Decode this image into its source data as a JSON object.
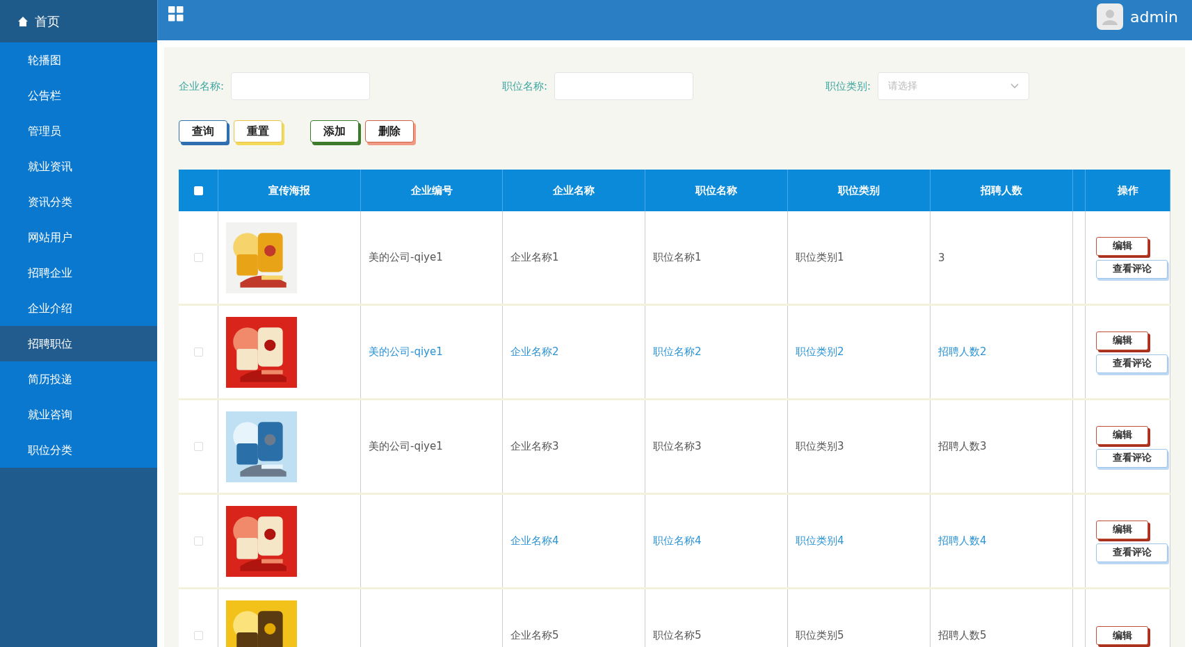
{
  "sidebar": {
    "home": "首页",
    "items": [
      {
        "label": "轮播图",
        "selected": false
      },
      {
        "label": "公告栏",
        "selected": false
      },
      {
        "label": "管理员",
        "selected": false
      },
      {
        "label": "就业资讯",
        "selected": false
      },
      {
        "label": "资讯分类",
        "selected": false
      },
      {
        "label": "网站用户",
        "selected": false
      },
      {
        "label": "招聘企业",
        "selected": false
      },
      {
        "label": "企业介绍",
        "selected": false
      },
      {
        "label": "招聘职位",
        "selected": true
      },
      {
        "label": "简历投递",
        "selected": false
      },
      {
        "label": "就业咨询",
        "selected": false
      },
      {
        "label": "职位分类",
        "selected": false
      }
    ]
  },
  "header": {
    "user": "admin"
  },
  "filters": [
    {
      "label": "企业名称:",
      "kind": "text"
    },
    {
      "label": "职位名称:",
      "kind": "text"
    },
    {
      "label": "职位类别:",
      "kind": "select",
      "placeholder": "请选择"
    }
  ],
  "buttons": [
    {
      "label": "查询",
      "kind": "query"
    },
    {
      "label": "重置",
      "kind": "reset"
    },
    {
      "label": "添加",
      "kind": "add"
    },
    {
      "label": "删除",
      "kind": "delete"
    }
  ],
  "table": {
    "select_all": {
      "checked": false
    },
    "columns": [
      "宣传海报",
      "企业编号",
      "企业名称",
      "职位名称",
      "职位类别",
      "招聘人数",
      "操作"
    ],
    "rows": [
      {
        "checked": false,
        "highlighted": false,
        "cells": [
          {
            "kind": "picture"
          },
          "美的公司-qiye1",
          "企业名称1",
          "职位名称1",
          "职位类别1",
          "3",
          {
            "kind": "actions",
            "actions": [
              "编辑",
              "查看评论"
            ]
          }
        ]
      },
      {
        "checked": false,
        "highlighted": true,
        "cells": [
          {
            "kind": "picture"
          },
          "美的公司-qiye1",
          "企业名称2",
          "职位名称2",
          "职位类别2",
          "招聘人数2",
          {
            "kind": "actions",
            "actions": [
              "编辑",
              "查看评论"
            ]
          }
        ]
      },
      {
        "checked": false,
        "highlighted": false,
        "cells": [
          {
            "kind": "picture"
          },
          "美的公司-qiye1",
          "企业名称3",
          "职位名称3",
          "职位类别3",
          "招聘人数3",
          {
            "kind": "actions",
            "actions": [
              "编辑",
              "查看评论"
            ]
          }
        ]
      },
      {
        "checked": false,
        "highlighted": true,
        "cells": [
          {
            "kind": "picture"
          },
          "",
          "企业名称4",
          "职位名称4",
          "职位类别4",
          "招聘人数4",
          {
            "kind": "actions",
            "actions": [
              "编辑",
              "查看评论"
            ]
          }
        ]
      },
      {
        "checked": false,
        "highlighted": false,
        "cells": [
          {
            "kind": "picture"
          },
          "",
          "企业名称5",
          "职位名称5",
          "职位类别5",
          "招聘人数5",
          {
            "kind": "actions",
            "actions": [
              "编辑"
            ]
          }
        ]
      }
    ]
  }
}
